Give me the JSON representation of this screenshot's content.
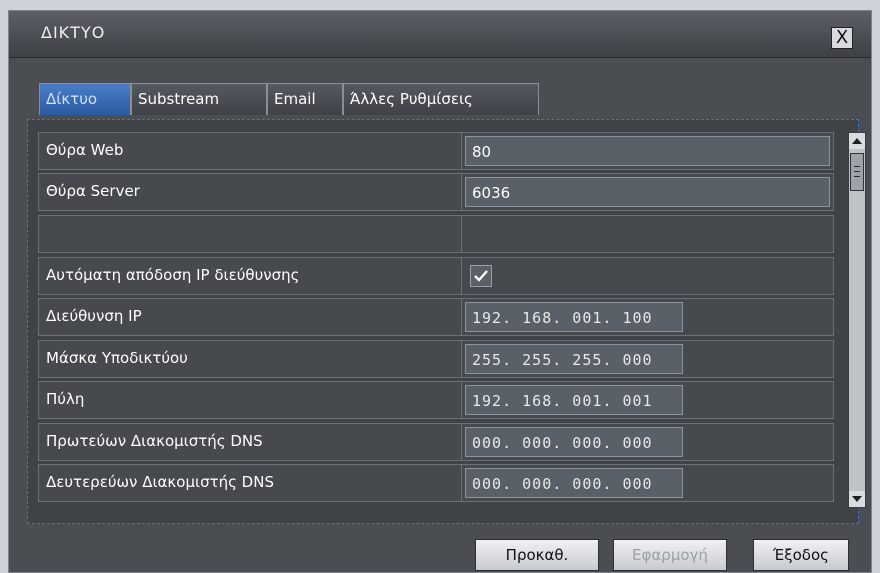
{
  "window": {
    "title": "ΔΙΚΤΥΟ",
    "close_label": "X"
  },
  "tabs": [
    {
      "label": "Δίκτυο",
      "active": true
    },
    {
      "label": "Substream",
      "active": false
    },
    {
      "label": "Email",
      "active": false
    },
    {
      "label": "Άλλες Ρυθμίσεις",
      "active": false
    }
  ],
  "rows": [
    {
      "label": "Θύρα Web",
      "value": "80"
    },
    {
      "label": "Θύρα Server",
      "value": "6036"
    },
    {
      "label": "",
      "value": ""
    },
    {
      "label": "Αυτόματη απόδοση IP διεύθυνσης",
      "checked": true
    },
    {
      "label": "Διεύθυνση IP",
      "value": "192. 168. 001. 100"
    },
    {
      "label": "Μάσκα Υποδικτύου",
      "value": "255. 255. 255. 000"
    },
    {
      "label": "Πύλη",
      "value": "192. 168. 001. 001"
    },
    {
      "label": "Πρωτεύων Διακομιστής DNS",
      "value": "000. 000. 000. 000"
    },
    {
      "label": "Δευτερεύων Διακομιστής DNS",
      "value": "000. 000. 000. 000"
    }
  ],
  "buttons": {
    "default_label": "Προκαθ.",
    "apply_label": "Εφαρμογή",
    "exit_label": "Έξοδος"
  },
  "colors": {
    "accent": "#2c5aa0",
    "panel_border": "#3f74c9"
  }
}
